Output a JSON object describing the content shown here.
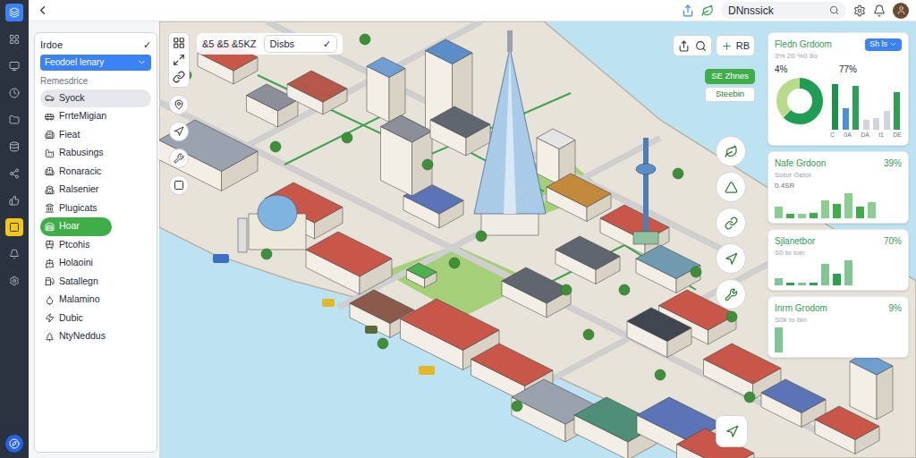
{
  "topbar": {
    "search": {
      "value": "DNnssick"
    }
  },
  "rail_items": [
    {
      "selected": false
    },
    {
      "selected": false
    },
    {
      "selected": false
    },
    {
      "selected": false
    },
    {
      "selected": false
    },
    {
      "selected": false
    },
    {
      "selected": false
    },
    {
      "selected": true
    },
    {
      "selected": false
    },
    {
      "selected": false
    }
  ],
  "sidebar": {
    "title": "Irdoe",
    "title_mark": "✓",
    "dropdown": {
      "label": "Feodoel lenary",
      "expanded": false
    },
    "section": "Remesdrice",
    "items": [
      {
        "label": "Syock",
        "selected": false,
        "hovered": true
      },
      {
        "label": "FrrteMigian",
        "selected": false,
        "hovered": false
      },
      {
        "label": "Fieat",
        "selected": false,
        "hovered": false
      },
      {
        "label": "Rabusings",
        "selected": false,
        "hovered": false
      },
      {
        "label": "Ronaracic",
        "selected": false,
        "hovered": false
      },
      {
        "label": "Ralsenier",
        "selected": false,
        "hovered": false
      },
      {
        "label": "Plugicats",
        "selected": false,
        "hovered": false
      },
      {
        "label": "Hoar",
        "selected": true,
        "hovered": false
      },
      {
        "label": "Ptcohis",
        "selected": false,
        "hovered": false
      },
      {
        "label": "Holaoini",
        "selected": false,
        "hovered": false
      },
      {
        "label": "Satallegn",
        "selected": false,
        "hovered": false
      },
      {
        "label": "Malamino",
        "selected": false,
        "hovered": false
      },
      {
        "label": "Dubic",
        "selected": false,
        "hovered": false
      },
      {
        "label": "NtyNeddus",
        "selected": false,
        "hovered": false
      }
    ]
  },
  "map": {
    "chip": "&5 &5 &5KZ",
    "filter": {
      "label": "Disbs",
      "mark": "✓"
    },
    "tool_label": "RB",
    "zones_button": {
      "label": "SE Zhnes",
      "selected": true
    },
    "station_button": {
      "label": "Steebin",
      "selected": false
    }
  },
  "cards": [
    {
      "title": "Fledn Grdoom",
      "badge": "Sh ls",
      "subtitle": "3% 20 %0 8o",
      "left_value": "4%",
      "right_value": "77%",
      "donut": [
        {
          "value": 62,
          "color": "#1f9d55"
        },
        {
          "value": 38,
          "color": "#b9dc8a"
        }
      ],
      "bars": [
        {
          "value": 85,
          "color": "#1f8f4e"
        },
        {
          "value": 40,
          "color": "#4a90d9"
        },
        {
          "value": 82,
          "color": "#2ea05a"
        },
        {
          "value": 18,
          "color": "#d1d5db"
        },
        {
          "value": 22,
          "color": "#d1d5db"
        },
        {
          "value": 35,
          "color": "#d1d5db"
        },
        {
          "value": 70,
          "color": "#2e9e4f"
        }
      ],
      "axis_labels": [
        "C",
        "0A",
        "DA",
        "I1",
        "DE"
      ]
    },
    {
      "title": "Nafe Grdoon",
      "value": "39%",
      "subtitle": "Sotor Gelor",
      "subtitle2": "0.4SR",
      "color": "#3fae49",
      "bars": [
        25,
        8,
        8,
        10,
        38,
        30,
        55,
        25,
        35
      ]
    },
    {
      "title": "Sjlanetbor",
      "value": "70%",
      "subtitle": "S0 to loin",
      "color": "#2e9e4f",
      "bars": [
        18,
        6,
        6,
        6,
        55,
        30,
        65
      ]
    },
    {
      "title": "Inrm Grodom",
      "value": "9%",
      "subtitle": "S0k to bin",
      "color": "#2e9e4f",
      "bars": [
        28
      ]
    }
  ]
}
